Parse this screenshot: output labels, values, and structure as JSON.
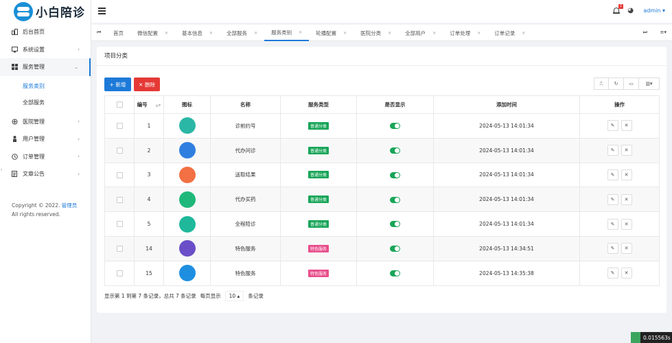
{
  "app": {
    "logo_text": "小白陪诊",
    "user": "admin ▾",
    "notif_count": "2"
  },
  "sidebar": {
    "items": [
      {
        "label": "后台首页",
        "icon": "dashboard-icon",
        "arrow": ""
      },
      {
        "label": "系统设置",
        "icon": "monitor-icon",
        "arrow": "›"
      },
      {
        "label": "服务管理",
        "icon": "grid-icon",
        "arrow": "⌄"
      },
      {
        "label": "医院管理",
        "icon": "hospital-icon",
        "arrow": "›"
      },
      {
        "label": "用户管理",
        "icon": "user-icon",
        "arrow": "›"
      },
      {
        "label": "订单管理",
        "icon": "order-icon",
        "arrow": "›"
      },
      {
        "label": "文章公告",
        "icon": "article-icon",
        "arrow": "›"
      }
    ],
    "sub_items": [
      "服务类别",
      "全部服务"
    ],
    "copyright_prefix": "Copyright © 2022.",
    "copyright_link": "管理员",
    "copyright_suffix": "All rights reserved."
  },
  "tabs": [
    {
      "label": "首页",
      "closable": false
    },
    {
      "label": "微信配置",
      "closable": true
    },
    {
      "label": "基本信息",
      "closable": true
    },
    {
      "label": "全部服务",
      "closable": true
    },
    {
      "label": "服务类别",
      "closable": true
    },
    {
      "label": "轮播配置",
      "closable": true
    },
    {
      "label": "医院分类",
      "closable": true
    },
    {
      "label": "全部用户",
      "closable": true
    },
    {
      "label": "订单处理",
      "closable": true
    },
    {
      "label": "订单记录",
      "closable": true
    }
  ],
  "card": {
    "title": "项目分类",
    "add_label": "+ 新增",
    "delete_label": "✕ 删除"
  },
  "table": {
    "headers": [
      "编号",
      "图标",
      "名称",
      "服务类型",
      "是否显示",
      "添加时间",
      "操作"
    ],
    "rows": [
      {
        "id": "1",
        "name": "诊前约号",
        "type": "普通分类",
        "time": "2024-05-13 14:01:34",
        "icon_color": "#2bb7a6",
        "type_color": "#18a558",
        "shown": true
      },
      {
        "id": "2",
        "name": "代办问诊",
        "type": "普通分类",
        "time": "2024-05-13 14:01:34",
        "icon_color": "#2f7fe0",
        "type_color": "#18a558",
        "shown": true
      },
      {
        "id": "3",
        "name": "送取结果",
        "type": "普通分类",
        "time": "2024-05-13 14:01:34",
        "icon_color": "#f27043",
        "type_color": "#18a558",
        "shown": true
      },
      {
        "id": "4",
        "name": "代办买药",
        "type": "普通分类",
        "time": "2024-05-13 14:01:34",
        "icon_color": "#1fb87a",
        "type_color": "#18a558",
        "shown": true
      },
      {
        "id": "5",
        "name": "全程陪诊",
        "type": "普通分类",
        "time": "2024-05-13 14:01:34",
        "icon_color": "#1fb89b",
        "type_color": "#18a558",
        "shown": true
      },
      {
        "id": "14",
        "name": "特色服务",
        "type": "特色服务",
        "time": "2024-05-13 14:34:51",
        "icon_color": "#6a4fc8",
        "type_color": "#e84f8c",
        "shown": true
      },
      {
        "id": "15",
        "name": "特色服务",
        "type": "特色服务",
        "time": "2024-05-13 14:35:38",
        "icon_color": "#1e8fe0",
        "type_color": "#e84f8c",
        "shown": true
      }
    ]
  },
  "pager": {
    "summary": "显示第 1 到第 7 条记录，总共 7 条记录",
    "per_page_prefix": "每页显示",
    "per_page": "10 ▴",
    "per_page_suffix": "条记录"
  },
  "perf": "0.015563s"
}
